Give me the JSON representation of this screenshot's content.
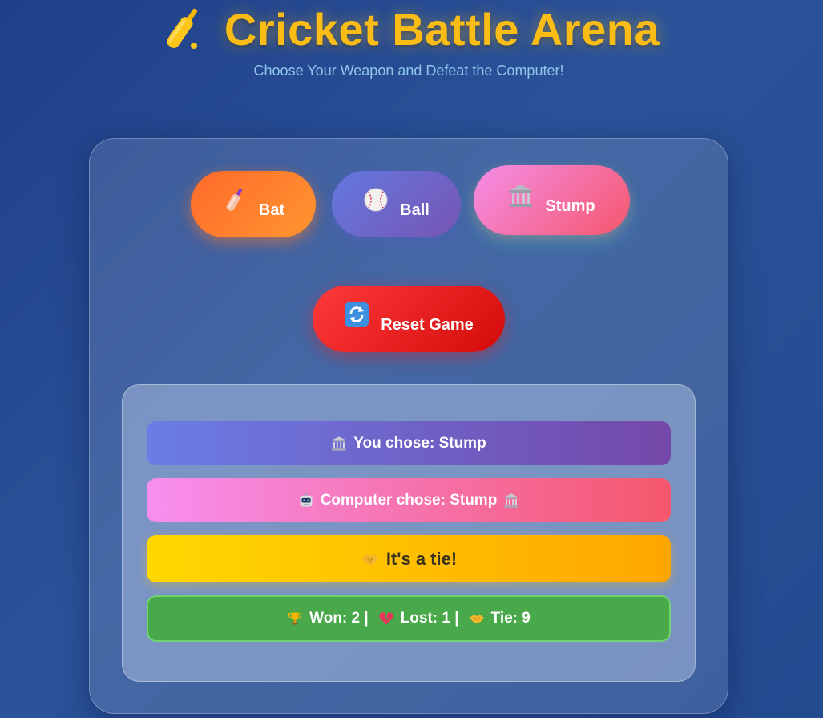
{
  "header": {
    "title": "Cricket Battle Arena",
    "subtitle": "Choose Your Weapon and Defeat the Computer!",
    "title_icon": "cricket-bat-icon"
  },
  "choices": [
    {
      "label": "Bat",
      "icon": "cricket-bat-icon"
    },
    {
      "label": "Ball",
      "icon": "baseball-icon"
    },
    {
      "label": "Stump",
      "icon": "classical-building-icon"
    }
  ],
  "reset": {
    "label": "Reset Game",
    "icon": "counterclockwise-arrows-icon"
  },
  "results": {
    "user_choice": "You chose: Stump",
    "computer_choice": "Computer chose: Stump",
    "outcome": "It's a tie!",
    "score": {
      "won_label": "Won: 2 |",
      "lost_label": "Lost: 1 |",
      "tie_label": "Tie: 9",
      "won": 2,
      "lost": 1,
      "tie": 9
    }
  },
  "colors": {
    "background": "#2b5399",
    "title": "#fbbd15",
    "subtitle": "#8ec6ec",
    "bat_button": "#ff7a2e",
    "ball_button": "#6a68c8",
    "stump_button": "#f57ea8",
    "reset_button": "#e81c1c",
    "user_row": "#6e66d0",
    "computer_row": "#f778b0",
    "result_row": "#ffc000",
    "score_row": "#48a84a"
  }
}
